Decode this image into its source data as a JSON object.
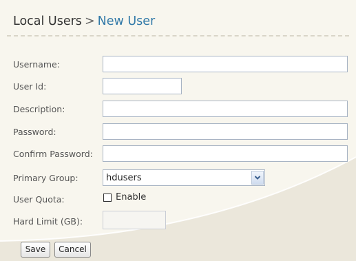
{
  "header": {
    "breadcrumb_root": "Local Users",
    "separator": ">",
    "current_page": "New User"
  },
  "form": {
    "username": {
      "label": "Username:",
      "value": ""
    },
    "user_id": {
      "label": "User Id:",
      "value": ""
    },
    "description": {
      "label": "Description:",
      "value": ""
    },
    "password": {
      "label": "Password:",
      "value": ""
    },
    "confirm_password": {
      "label": "Confirm Password:",
      "value": ""
    },
    "primary_group": {
      "label": "Primary Group:",
      "selected": "hdusers"
    },
    "user_quota": {
      "label": "User Quota:",
      "checkbox_label": "Enable",
      "checked": false
    },
    "hard_limit": {
      "label": "Hard Limit (GB):",
      "value": ""
    }
  },
  "buttons": {
    "save": "Save",
    "cancel": "Cancel"
  },
  "colors": {
    "background": "#f8f6ee",
    "accent_title": "#3179a8",
    "input_border": "#a8b4c4"
  },
  "icons": {
    "dropdown": "chevron-down-icon"
  }
}
